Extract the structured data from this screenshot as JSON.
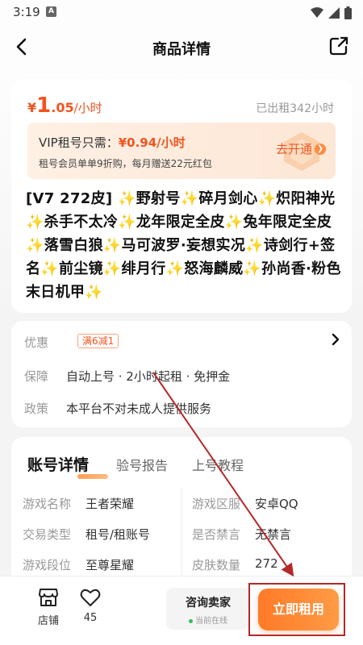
{
  "status_bar": {
    "time": "3:19",
    "badge": "A"
  },
  "header": {
    "title": "商品详情"
  },
  "product": {
    "price_yen": "¥",
    "price_int": "1",
    "price_dec": ".05",
    "price_unit": "/小时",
    "rented": "已出租342小时",
    "vip_prefix": "VIP租号只需：",
    "vip_price": "¥0.94/小时",
    "vip_desc": "租号会员单单9折购，每月赠送22元红包",
    "vip_open": "去开通",
    "title": "[V7 272皮] ✨野射号✨碎月剑心✨炽阳神光✨杀手不太冷✨龙年限定全皮✨兔年限定全皮✨落雪白狼✨马可波罗·妄想实况✨诗剑行+签名✨前尘镜✨绯月行✨怒海麟威✨孙尚香·粉色末日机甲✨"
  },
  "info": {
    "promo_label": "优惠",
    "promo_tag": "满6减1",
    "guarantee_label": "保障",
    "guarantee_value": "自动上号 · 2小时起租 · 免押金",
    "policy_label": "政策",
    "policy_value": "本平台不对未成人提供服务"
  },
  "detail": {
    "tabs": [
      "账号详情",
      "验号报告",
      "上号教程"
    ],
    "rows": [
      {
        "l_label": "游戏名称",
        "l_value": "王者荣耀",
        "r_label": "游戏区服",
        "r_value": "安卓QQ"
      },
      {
        "l_label": "交易类型",
        "l_value": "租号/租账号",
        "r_label": "是否禁言",
        "r_value": "无禁言"
      },
      {
        "l_label": "游戏段位",
        "l_value": "至尊星耀",
        "r_label": "皮肤数量",
        "r_value": "272"
      }
    ]
  },
  "bottom": {
    "shop_label": "店铺",
    "fav_count": "45",
    "consult_title": "咨询卖家",
    "consult_status": "当前在线",
    "rent_label": "立即租用"
  },
  "colors": {
    "accent": "#f2541f",
    "button": "#ff8a35",
    "annotation": "#b42828"
  }
}
